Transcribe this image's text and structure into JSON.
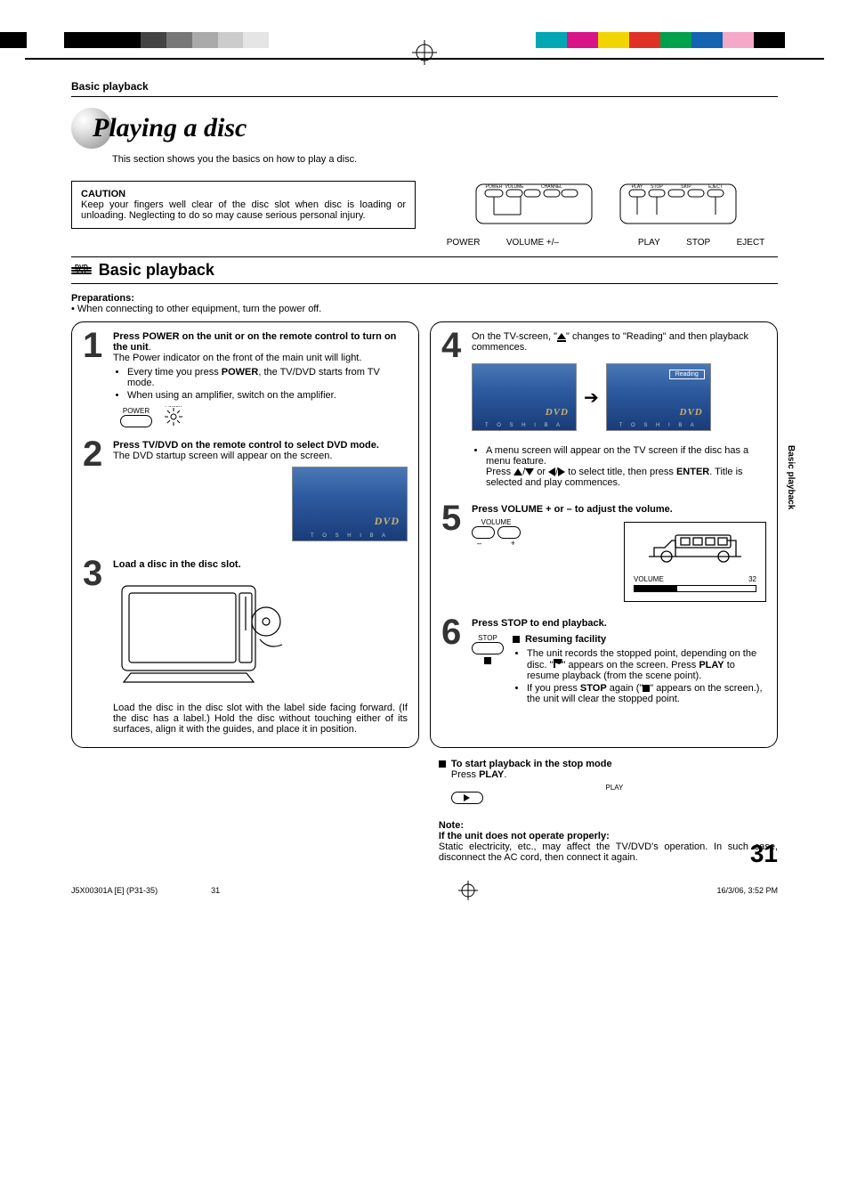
{
  "header": {
    "section_label": "Basic playback"
  },
  "title": "Playing a disc",
  "intro": "This section shows you the basics on how to play a disc.",
  "caution": {
    "heading": "CAUTION",
    "body": "Keep your fingers well clear of the disc slot when disc is loading or unloading. Neglecting to do so may cause serious personal injury."
  },
  "panel": {
    "top_labels": [
      "POWER",
      "VOLUME",
      "CHANNEL",
      "PLAY",
      "STOP",
      "SKIP",
      "EJECT"
    ],
    "below_left": [
      "POWER",
      "VOLUME +/–"
    ],
    "below_right": [
      "PLAY",
      "STOP",
      "EJECT"
    ]
  },
  "basic_heading": "Basic playback",
  "disc_types": [
    "DVD",
    "VCD",
    "CD"
  ],
  "prep": {
    "heading": "Preparations:",
    "bullet": "When connecting to other equipment, turn the power off."
  },
  "steps_left": [
    {
      "n": "1",
      "headline_pre": "Press POWER on the unit or on the remote control to turn on the unit",
      "headline_post": ".",
      "sub1": "The Power indicator on the front of the main unit will light.",
      "bullets": [
        {
          "pre": "Every time you press ",
          "strong": "POWER",
          "post": ", the TV/DVD starts from TV mode."
        },
        {
          "pre": "When using an amplifier, switch on the amplifier.",
          "strong": "",
          "post": ""
        }
      ],
      "btn_label": "POWER"
    },
    {
      "n": "2",
      "headline_pre": "Press TV/DVD on the remote control to select DVD mode.",
      "sub1": "The DVD startup screen will appear on the screen."
    },
    {
      "n": "3",
      "headline_pre": "Load a disc in the disc slot.",
      "after_img": "Load the disc in the disc slot with the label side facing forward. (If the disc has a label.) Hold the disc without touching either of its surfaces, align it with the guides, and place it in position."
    }
  ],
  "steps_right": [
    {
      "n": "4",
      "body_pre": "On the TV-screen, \"",
      "body_post": "\" changes to \"Reading\" and then playback commences.",
      "reading_label": "Reading",
      "menu_text": "A menu screen will appear on the TV screen if the disc has a menu feature.",
      "menu_text2_pre": "Press ",
      "menu_text2_mid": " to select title, then press ",
      "menu_text2_strong": "ENTER",
      "menu_text2_post": ". Title is selected and play commences."
    },
    {
      "n": "5",
      "headline": "Press VOLUME + or – to adjust the volume.",
      "btn_label": "VOLUME",
      "minus": "–",
      "plus": "+",
      "osd_label": "VOLUME",
      "osd_value": "32"
    },
    {
      "n": "6",
      "headline": "Press STOP to end playback.",
      "btn_label": "STOP",
      "resume_heading": "Resuming facility",
      "b1_pre": "The unit records the stopped point, depending on the disc. \"",
      "b1_mid": "\" appears on the screen. Press ",
      "b1_strong": "PLAY",
      "b1_post": " to resume playback (from the scene point).",
      "b2_pre": "If you press ",
      "b2_strong": "STOP",
      "b2_mid": " again (\"",
      "b2_post": "\" appears on the screen.), the unit will clear the stopped point."
    }
  ],
  "start_stop": {
    "heading": "To start playback in the stop mode",
    "body_pre": "Press ",
    "body_strong": "PLAY",
    "body_post": ".",
    "btn_label": "PLAY"
  },
  "note": {
    "heading": "Note:",
    "sub": "If the unit does not operate properly:",
    "body": "Static electricity, etc., may affect the TV/DVD's operation. In such case, disconnect the AC cord, then connect it again."
  },
  "side_tab": "Basic playback",
  "page_number": "31",
  "footer": {
    "doc_id": "J5X00301A [E] (P31-35)",
    "folio": "31",
    "timestamp": "16/3/06, 3:52 PM"
  },
  "colors": {
    "bar_bk": "#000000",
    "bar_c": "#00a7b5",
    "bar_m": "#d9138a",
    "bar_y": "#f2d500",
    "bar_r": "#e03127",
    "bar_g": "#00a14b",
    "bar_b": "#1263b2",
    "bar_pk": "#f6a8c8"
  }
}
